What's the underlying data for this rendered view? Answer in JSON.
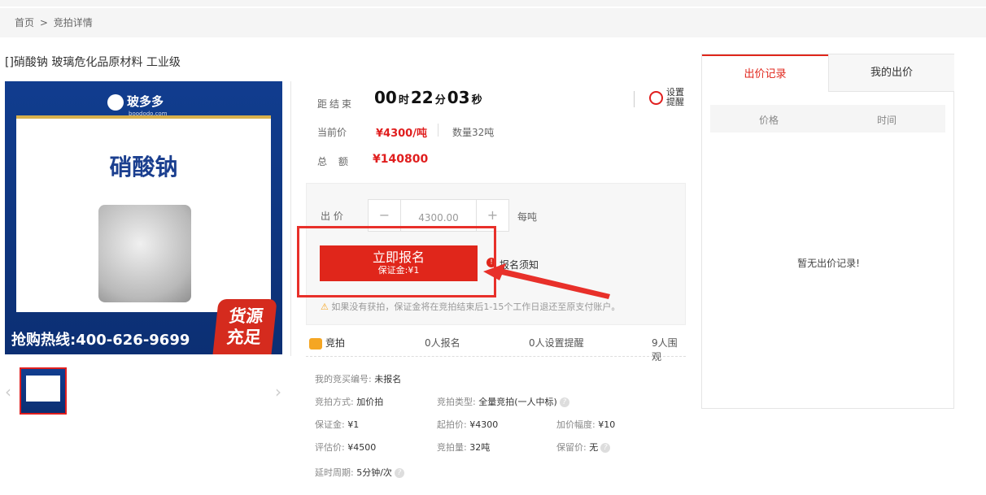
{
  "breadcrumb": {
    "home": "首页",
    "sep": ">",
    "current": "竞拍详情"
  },
  "product": {
    "title": "[]硝酸钠 玻璃危化品原材料 工业级",
    "image": {
      "brand": "玻多多",
      "brand_domain": "boododo.com",
      "name": "硝酸钠",
      "hotline": "抢购热线:400-626-9699",
      "badge_line1": "货源",
      "badge_line2": "充足"
    }
  },
  "auction": {
    "countdown_label": "距结束",
    "hours": "00",
    "hours_unit": "时",
    "minutes": "22",
    "minutes_unit": "分",
    "seconds": "03",
    "seconds_unit": "秒",
    "remind_line1": "设置",
    "remind_line2": "提醒",
    "price_label": "当前价",
    "price": "¥4300/吨",
    "quantity": "数量32吨",
    "total_label": "总 额",
    "total": "¥140800"
  },
  "bid": {
    "label": "出 价",
    "minus": "−",
    "value": "4300.00",
    "plus": "+",
    "unit": "每吨",
    "signup_button": "立即报名",
    "signup_sub": "保证金:¥1",
    "notice_icon": "!",
    "notice_link": "报名须知",
    "warning": "如果没有获拍，保证金将在竞拍结束后1-15个工作日退还至原支付账户。"
  },
  "stats": {
    "type": "竞拍",
    "signed": "0人报名",
    "reminders": "0人设置提醒",
    "viewers": "9人围观"
  },
  "details": {
    "bid_no_label": "我的竞买编号:",
    "bid_no": "未报名",
    "method_label": "竞拍方式:",
    "method": "加价拍",
    "kind_label": "竞拍类型:",
    "kind": "全量竞拍(一人中标)",
    "deposit_label": "保证金:",
    "deposit": "¥1",
    "start_label": "起拍价:",
    "start": "¥4300",
    "increment_label": "加价幅度:",
    "increment": "¥10",
    "estimate_label": "评估价:",
    "estimate": "¥4500",
    "amount_label": "竞拍量:",
    "amount": "32吨",
    "reserve_label": "保留价:",
    "reserve": "无",
    "delay_label": "延时周期:",
    "delay": "5分钟/次",
    "help": "?"
  },
  "records": {
    "tab_records": "出价记录",
    "tab_mine": "我的出价",
    "col_price": "价格",
    "col_time": "时间",
    "empty": "暂无出价记录!"
  },
  "colors": {
    "accent": "#e0261b",
    "annotation": "#e8302a"
  }
}
